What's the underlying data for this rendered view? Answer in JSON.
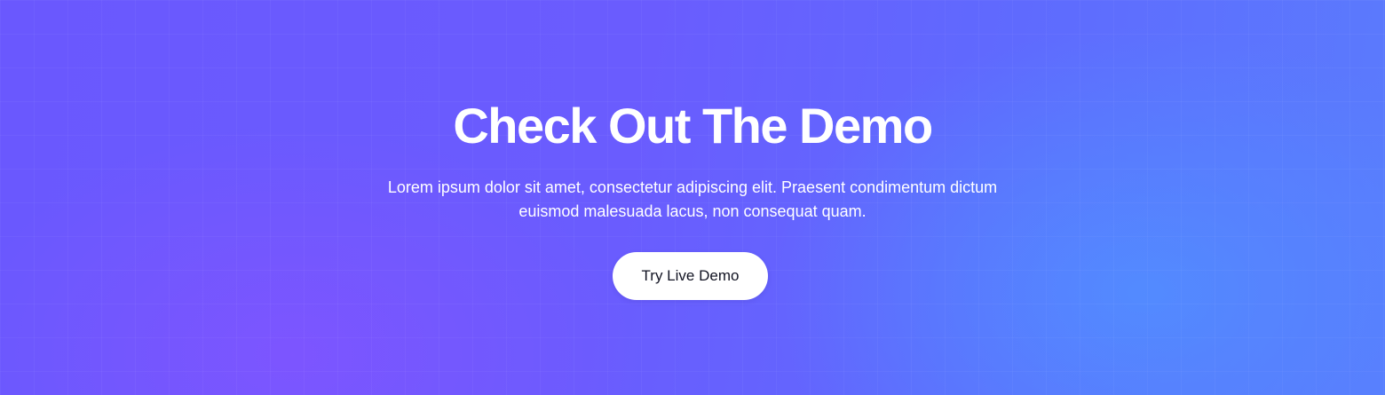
{
  "hero": {
    "title": "Check Out The Demo",
    "description": "Lorem ipsum dolor sit amet, consectetur adipiscing elit. Praesent condimentum dictum euismod malesuada lacus, non consequat quam.",
    "cta_label": "Try Live Demo"
  },
  "colors": {
    "background_primary": "#6a5cfe",
    "background_accent_blue": "#528cff",
    "background_accent_violet": "#8054ff",
    "button_background": "#ffffff",
    "button_text": "#111322",
    "text": "#ffffff"
  }
}
